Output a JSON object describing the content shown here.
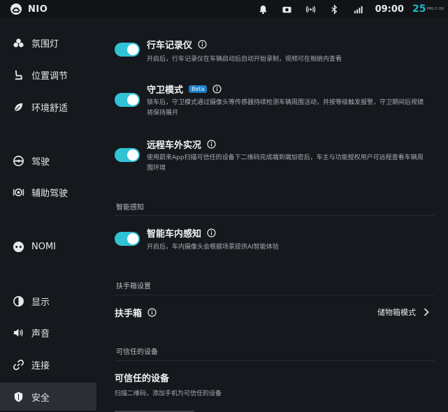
{
  "status": {
    "brand": "NIO",
    "time": "09:00",
    "temperature": "25",
    "temp_detail": "PM2.5 ON",
    "icons": [
      "bell-icon",
      "camera-icon",
      "signal-broadcast-icon",
      "bluetooth-icon",
      "cellular-5g-icon"
    ]
  },
  "sidebar": {
    "items": [
      {
        "label": "氛围灯",
        "icon": "ambient-light-icon"
      },
      {
        "label": "位置调节",
        "icon": "seat-icon"
      },
      {
        "label": "环境舒适",
        "icon": "leaf-icon"
      },
      {
        "label": "驾驶",
        "icon": "steering-wheel-icon"
      },
      {
        "label": "辅助驾驶",
        "icon": "assist-driving-icon"
      },
      {
        "label": "NOMI",
        "icon": "nomi-icon"
      },
      {
        "label": "显示",
        "icon": "display-icon"
      },
      {
        "label": "声音",
        "icon": "speaker-icon"
      },
      {
        "label": "连接",
        "icon": "link-icon"
      },
      {
        "label": "安全",
        "icon": "shield-icon",
        "active": true
      }
    ]
  },
  "main": {
    "dashcam": {
      "title": "行车记录仪",
      "enabled": true,
      "desc": "开启后，行车记录仪在车辆启动后自动开始录制，视频可在相册内查看"
    },
    "guard": {
      "title": "守卫模式",
      "badge": "Beta",
      "enabled": true,
      "desc": "锁车后，守卫模式通过摄像头等传感器持续检测车辆周围活动，并按等级触发报警，守卫期间后视镜将保持展开"
    },
    "remote_view": {
      "title": "远程车外实况",
      "enabled": true,
      "desc": "使用蔚来App扫描可信任的设备下二维码完成端到端加密后，车主与功能授权用户可远程查看车辆周围环境"
    },
    "section_smart": "智能感知",
    "cabin_sense": {
      "title": "智能车内感知",
      "enabled": true,
      "desc": "开启后，车内摄像头会根据场景提供AI智能体验"
    },
    "section_armrest": "扶手箱设置",
    "armrest": {
      "title": "扶手箱",
      "value": "储物箱模式"
    },
    "section_trusted": "可信任的设备",
    "trusted": {
      "title": "可信任的设备",
      "desc": "扫描二维码，添加手机为可信任的设备"
    }
  },
  "colors": {
    "accent": "#30c3d6",
    "background": "#15181c",
    "active_item": "#2b2f35",
    "badge": "#1f7fc4"
  }
}
